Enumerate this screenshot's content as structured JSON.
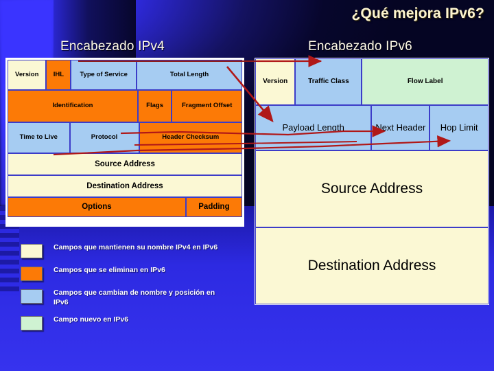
{
  "slide": {
    "title": "¿Qué mejora IPv6?",
    "ipv4_title": "Encabezado IPv4",
    "ipv6_title": "Encabezado IPv6"
  },
  "colors": {
    "keep": "#FBF8D4",
    "removed": "#FC7A06",
    "renamed": "#A6CCF2",
    "new": "#CFF2D2",
    "background": "#2B2BE8",
    "title_text": "#FDF5D0",
    "arrow": "#B01818",
    "border": "#3C3CC8"
  },
  "ipv4_header": {
    "rows": [
      {
        "fields": [
          {
            "label": "Version",
            "width_pct": 16.5,
            "color": "keep"
          },
          {
            "label": "IHL",
            "width_pct": 10.5,
            "color": "removed"
          },
          {
            "label": "Type of Service",
            "width_pct": 28.0,
            "color": "renamed"
          },
          {
            "label": "Total Length",
            "width_pct": 45.0,
            "color": "renamed"
          }
        ]
      },
      {
        "fields": [
          {
            "label": "Identification",
            "width_pct": 55.5,
            "color": "removed"
          },
          {
            "label": "Flags",
            "width_pct": 14.5,
            "color": "removed"
          },
          {
            "label": "Fragment Offset",
            "width_pct": 30.0,
            "color": "removed"
          }
        ]
      },
      {
        "fields": [
          {
            "label": "Time to Live",
            "width_pct": 26.5,
            "color": "renamed"
          },
          {
            "label": "Protocol",
            "width_pct": 29.5,
            "color": "renamed"
          },
          {
            "label": "Header Checksum",
            "width_pct": 44.0,
            "color": "removed"
          }
        ]
      },
      {
        "fields": [
          {
            "label": "Source Address",
            "width_pct": 100,
            "color": "keep"
          }
        ]
      },
      {
        "fields": [
          {
            "label": "Destination Address",
            "width_pct": 100,
            "color": "keep"
          }
        ]
      },
      {
        "fields": [
          {
            "label": "Options",
            "width_pct": 76.0,
            "color": "removed"
          },
          {
            "label": "Padding",
            "width_pct": 24.0,
            "color": "removed"
          }
        ]
      }
    ]
  },
  "ipv6_header": {
    "rows": [
      {
        "fields": [
          {
            "label": "Version",
            "width_pct": 17.2,
            "color": "keep"
          },
          {
            "label": "Traffic Class",
            "width_pct": 28.5,
            "color": "renamed"
          },
          {
            "label": "Flow Label",
            "width_pct": 54.3,
            "color": "new"
          }
        ]
      },
      {
        "fields": [
          {
            "label": "Payload Length",
            "width_pct": 49.8,
            "color": "renamed"
          },
          {
            "label": "Next Header",
            "width_pct": 25.0,
            "color": "renamed"
          },
          {
            "label": "Hop Limit",
            "width_pct": 25.2,
            "color": "renamed"
          }
        ]
      },
      {
        "fields": [
          {
            "label": "Source Address",
            "width_pct": 100,
            "color": "keep"
          }
        ]
      },
      {
        "fields": [
          {
            "label": "Destination Address",
            "width_pct": 100,
            "color": "keep"
          }
        ]
      }
    ]
  },
  "legend": {
    "items": [
      {
        "color": "keep",
        "text": "Campos que mantienen su nombre IPv4 en IPv6"
      },
      {
        "color": "removed",
        "text": "Campos que se eliminan en IPv6"
      },
      {
        "color": "renamed",
        "text": "Campos que cambian de nombre y posición en IPv6"
      },
      {
        "color": "new",
        "text": "Campo nuevo en IPv6"
      }
    ]
  }
}
